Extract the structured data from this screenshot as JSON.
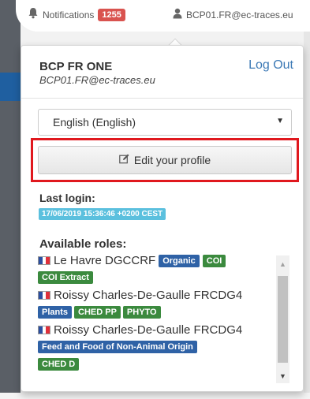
{
  "topbar": {
    "notifications_label": "Notifications",
    "notifications_count": "1255",
    "user_email": "BCP01.FR@ec-traces.eu"
  },
  "dropdown": {
    "user_name": "BCP FR ONE",
    "user_email": "BCP01.FR@ec-traces.eu",
    "logout_label": "Log Out",
    "language_value": "English (English)",
    "edit_profile_label": "Edit your profile",
    "last_login_label": "Last login:",
    "last_login_value": "17/06/2019 15:36:46 +0200 CEST",
    "roles_label": "Available roles:",
    "roles": [
      {
        "name": "Le Havre DGCCRF",
        "tags": [
          "Organic",
          "COI",
          "COI Extract"
        ]
      },
      {
        "name": "Roissy Charles-De-Gaulle FRCDG4",
        "tags": [
          "Plants",
          "CHED PP",
          "PHYTO"
        ]
      },
      {
        "name": "Roissy Charles-De-Gaulle FRCDG4",
        "tags": [
          "Feed and Food of Non-Animal Origin",
          "CHED D"
        ]
      }
    ]
  },
  "colors": {
    "accent": "#3c79b5",
    "badge_red": "#d9534f",
    "badge_info": "#5bc0de",
    "tag_blue": "#2f62a6",
    "tag_green": "#3b8a3e",
    "highlight_outline": "#e0181e"
  },
  "icons": {
    "notifications": "bell-icon",
    "user": "user-icon",
    "edit": "pencil-square-icon",
    "flag": "france-flag-icon"
  }
}
